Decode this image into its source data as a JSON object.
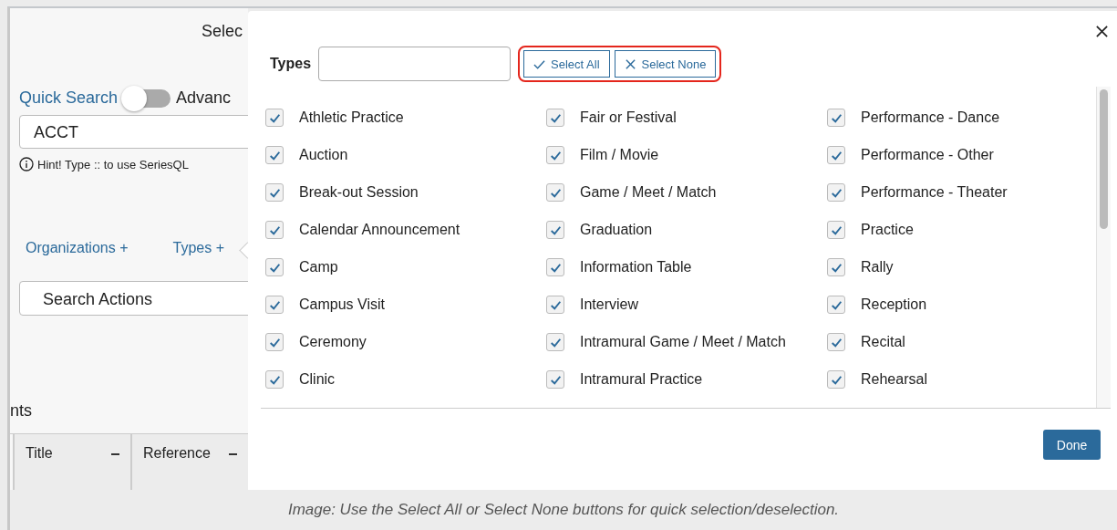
{
  "background": {
    "heading": "Selec",
    "quick_search": {
      "label": "Quick Search",
      "advanced_on": false,
      "advanced_label": "Advanc"
    },
    "search": {
      "value": "ACCT"
    },
    "hint": "Hint! Type :: to use SeriesQL",
    "filters": [
      "Organizations +",
      "Types +"
    ],
    "actions": {
      "placeholder": "Search Actions"
    },
    "section_heading": "nts",
    "table": {
      "columns": [
        "Title",
        "Reference"
      ]
    }
  },
  "modal": {
    "label": "Types",
    "buttons": [
      {
        "label": "Select All",
        "kind": "check"
      },
      {
        "label": "Select None",
        "kind": "cross"
      }
    ],
    "types": [
      {
        "label": "Athletic Practice",
        "checked": true
      },
      {
        "label": "Fair or Festival",
        "checked": true
      },
      {
        "label": "Performance - Dance",
        "checked": true
      },
      {
        "label": "Auction",
        "checked": true
      },
      {
        "label": "Film / Movie",
        "checked": true
      },
      {
        "label": "Performance - Other",
        "checked": true
      },
      {
        "label": "Break-out Session",
        "checked": true
      },
      {
        "label": "Game / Meet / Match",
        "checked": true
      },
      {
        "label": "Performance - Theater",
        "checked": true
      },
      {
        "label": "Calendar Announcement",
        "checked": true
      },
      {
        "label": "Graduation",
        "checked": true
      },
      {
        "label": "Practice",
        "checked": true
      },
      {
        "label": "Camp",
        "checked": true
      },
      {
        "label": "Information Table",
        "checked": true
      },
      {
        "label": "Rally",
        "checked": true
      },
      {
        "label": "Campus Visit",
        "checked": true
      },
      {
        "label": "Interview",
        "checked": true
      },
      {
        "label": "Reception",
        "checked": true
      },
      {
        "label": "Ceremony",
        "checked": true
      },
      {
        "label": "Intramural Game / Meet / Match",
        "checked": true
      },
      {
        "label": "Recital",
        "checked": true
      },
      {
        "label": "Clinic",
        "checked": true
      },
      {
        "label": "Intramural Practice",
        "checked": true
      },
      {
        "label": "Rehearsal",
        "checked": true
      }
    ],
    "done": "Done"
  },
  "caption": "Image: Use the Select All or Select None buttons for quick selection/deselection."
}
